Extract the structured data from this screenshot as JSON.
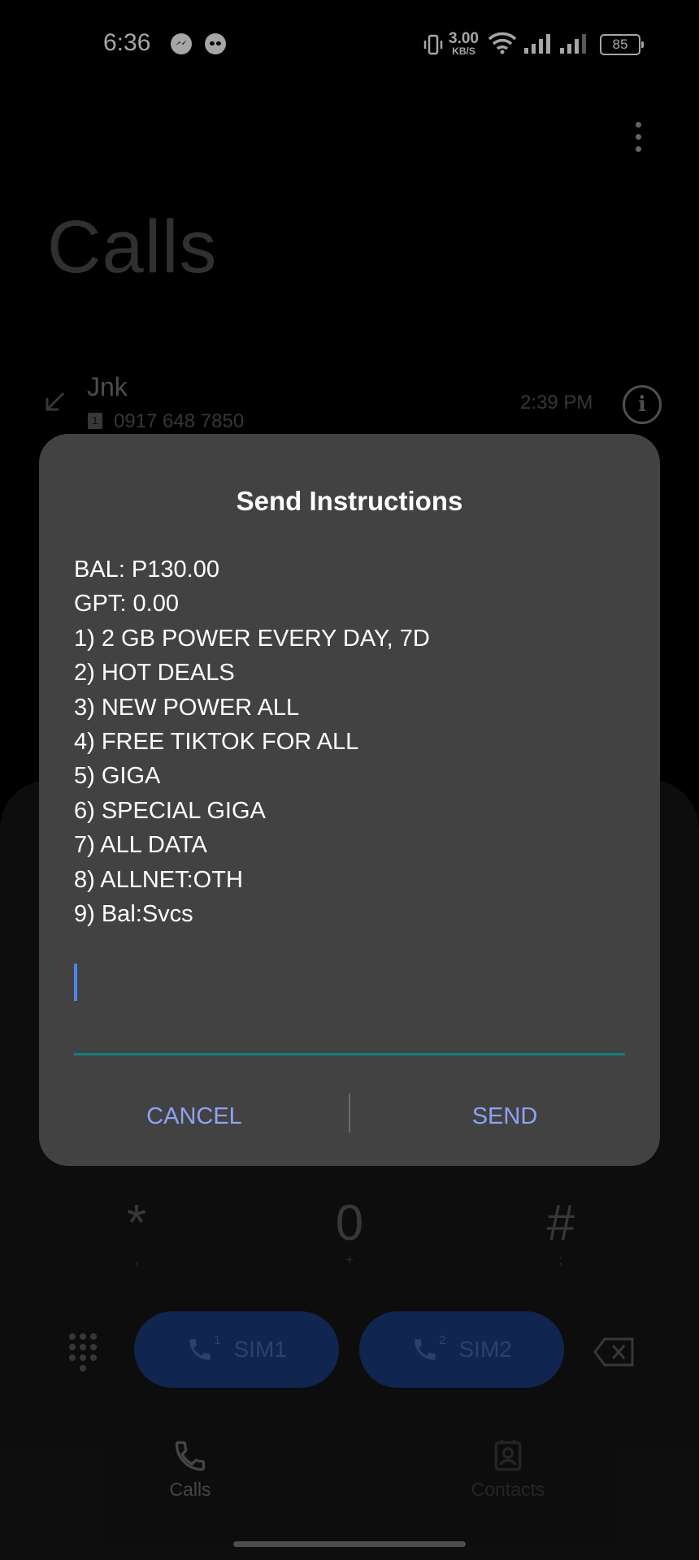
{
  "status_bar": {
    "time": "6:36",
    "net_speed_value": "3.00",
    "net_speed_unit": "KB/S",
    "battery": "85",
    "icons": [
      "messenger-icon",
      "alien-icon",
      "vibrate-icon",
      "wifi-icon",
      "signal-icon",
      "signal-icon",
      "battery-icon"
    ]
  },
  "header": {
    "title": "Calls"
  },
  "recent_call": {
    "name": "Jnk",
    "sim": "1",
    "number": "0917 648 7850",
    "time": "2:39 PM"
  },
  "dialog": {
    "title": "Send Instructions",
    "message_lines": [
      "BAL: P130.00",
      "GPT: 0.00",
      "1) 2 GB POWER EVERY DAY, 7D",
      "2) HOT DEALS",
      "3) NEW POWER ALL",
      "4) FREE TIKTOK FOR ALL",
      "5) GIGA",
      "6) SPECIAL GIGA",
      "7) ALL DATA",
      "8) ALLNET:OTH",
      "9) Bal:Svcs"
    ],
    "input_value": "",
    "cancel_label": "CANCEL",
    "send_label": "SEND"
  },
  "dialer": {
    "keys": [
      {
        "digit": "*",
        "sub": ","
      },
      {
        "digit": "0",
        "sub": "+"
      },
      {
        "digit": "#",
        "sub": ";"
      }
    ],
    "sim1_label": "SIM1",
    "sim1_num": "1",
    "sim2_label": "SIM2",
    "sim2_num": "2"
  },
  "bottom_nav": {
    "calls_label": "Calls",
    "contacts_label": "Contacts"
  },
  "colors": {
    "dialog_bg": "#424242",
    "accent_button": "#8ea2f4",
    "input_underline": "#12807a",
    "caret": "#4a86e8",
    "sim_button": "#1a3a7a"
  }
}
